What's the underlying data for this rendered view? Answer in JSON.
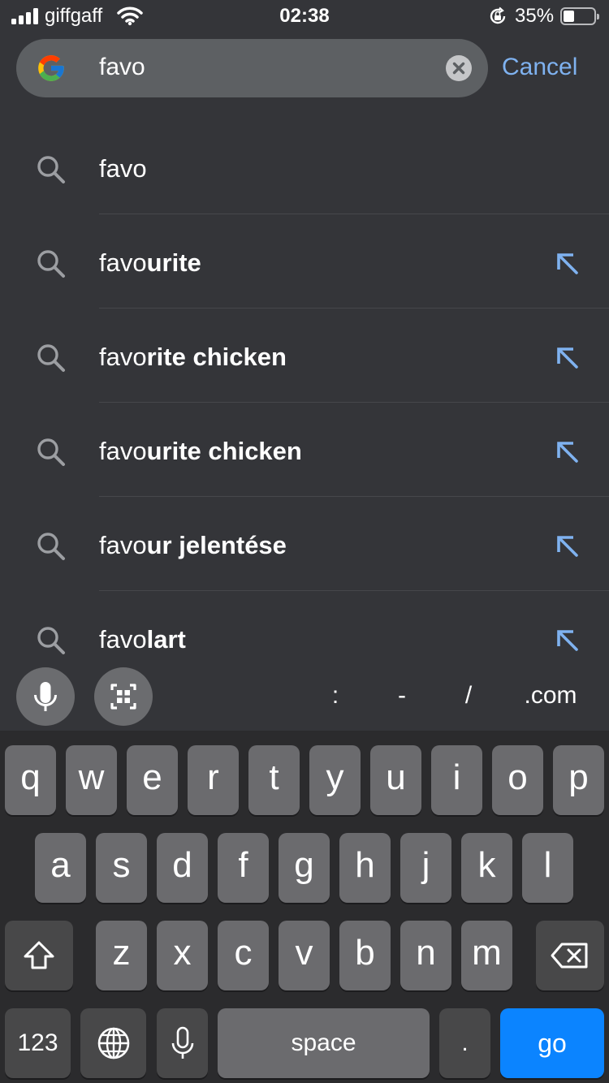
{
  "status_bar": {
    "carrier": "giffgaff",
    "time": "02:38",
    "battery": "35%",
    "battery_level": 0.35,
    "icons": [
      "signal-icon",
      "wifi-icon",
      "orientation-lock-icon",
      "battery-icon"
    ]
  },
  "search": {
    "logo": "google-g-logo",
    "query": "favo",
    "cancel_label": "Cancel"
  },
  "suggestions": [
    {
      "prefix": "favo",
      "suffix": "",
      "has_arrow": false
    },
    {
      "prefix": "favo",
      "suffix": "urite",
      "has_arrow": true
    },
    {
      "prefix": "favo",
      "suffix": "rite chicken",
      "has_arrow": true
    },
    {
      "prefix": "favo",
      "suffix": "urite chicken",
      "has_arrow": true
    },
    {
      "prefix": "favo",
      "suffix": "ur jelentése",
      "has_arrow": true
    },
    {
      "prefix": "favo",
      "suffix": "lart",
      "has_arrow": true
    }
  ],
  "toolbar": {
    "shortcuts": [
      ":",
      "-",
      "/",
      ".com"
    ]
  },
  "keyboard": {
    "row1": [
      "q",
      "w",
      "e",
      "r",
      "t",
      "y",
      "u",
      "i",
      "o",
      "p"
    ],
    "row2": [
      "a",
      "s",
      "d",
      "f",
      "g",
      "h",
      "j",
      "k",
      "l"
    ],
    "row3": [
      "z",
      "x",
      "c",
      "v",
      "b",
      "n",
      "m"
    ],
    "numbers_label": "123",
    "space_label": "space",
    "period_label": ".",
    "go_label": "go"
  },
  "colors": {
    "background": "#343539",
    "search_field": "#5d6063",
    "accent": "#7fb2f0",
    "key": "#6b6b6e",
    "key_dark": "#484849",
    "go_key": "#0b84ff"
  }
}
